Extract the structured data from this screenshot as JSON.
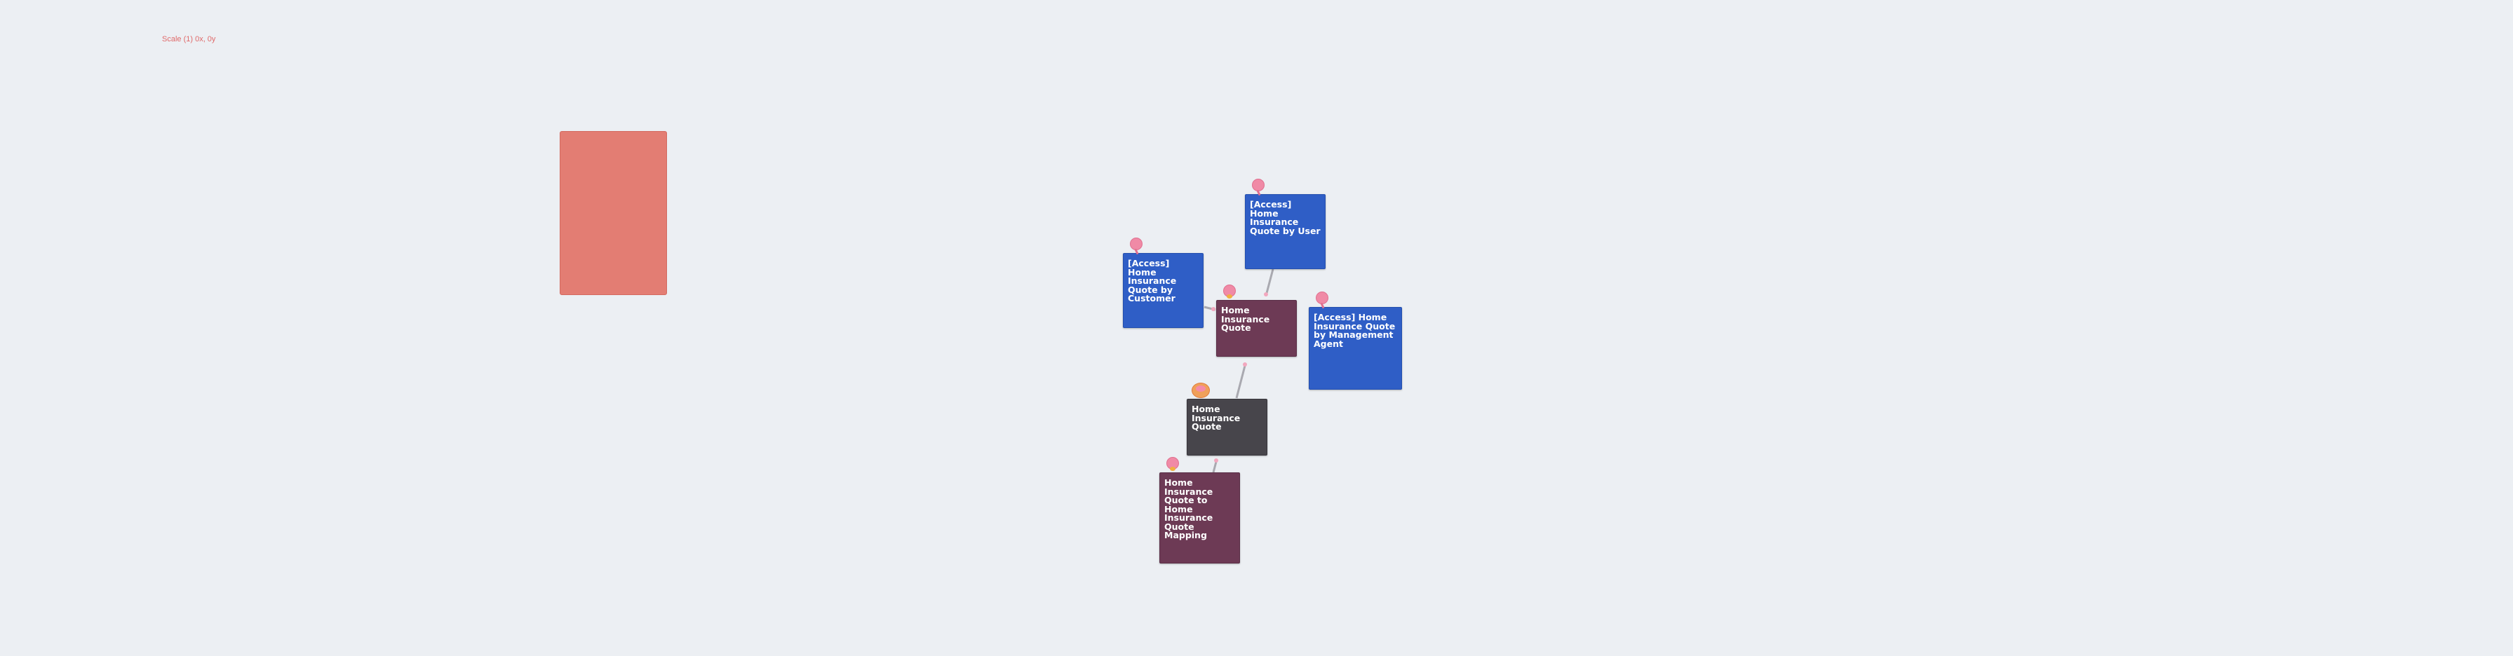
{
  "scale_label": "Scale (1) 0x, 0y",
  "nodes": {
    "access_by_user": "[Access] Home Insurance Quote by User",
    "access_by_customer": "[Access] Home Insurance Quote by Customer",
    "home_insurance_quote_entity": "Home Insurance Quote",
    "access_by_management_agent": "[Access] Home Insurance Quote by Management Agent",
    "home_insurance_quote_source": "Home Insurance Quote",
    "quote_mapping": "Home Insurance Quote to Home Insurance Quote Mapping"
  },
  "colors": {
    "background": "#eceff3",
    "group": "#e37d73",
    "access_node": "#2f5ec6",
    "entity_node": "#6d3a55",
    "source_node": "#47454b",
    "connector": "#a9a9b0",
    "connector_dot": "#f2a7be"
  },
  "icons": {
    "user_badge": "person-pin-icon",
    "source_badge": "database-owner-icon"
  }
}
